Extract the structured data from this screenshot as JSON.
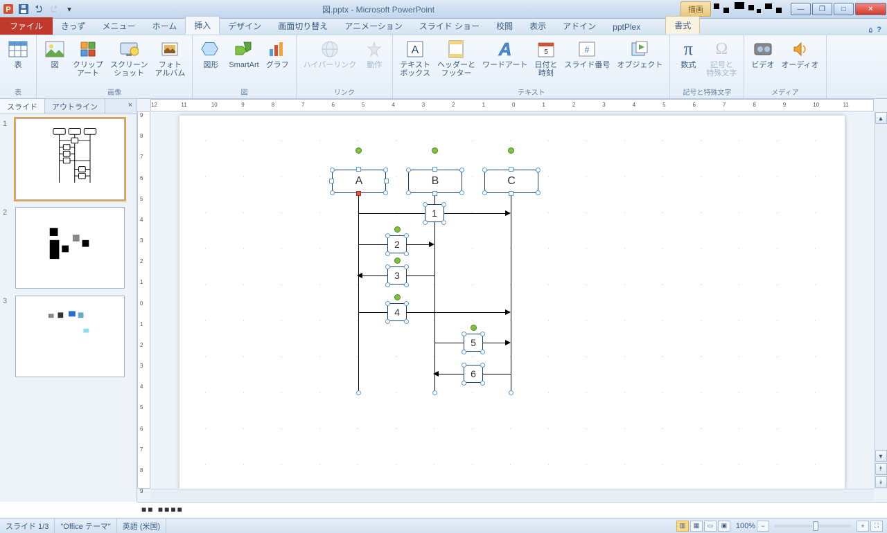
{
  "title": "図.pptx - Microsoft PowerPoint",
  "contextTab": "描画",
  "tabs": {
    "file": "ファイル",
    "kids": "きっず",
    "menu": "メニュー",
    "home": "ホーム",
    "insert": "挿入",
    "design": "デザイン",
    "transition": "画面切り替え",
    "animation": "アニメーション",
    "slideshow": "スライド ショー",
    "review": "校閲",
    "view": "表示",
    "addin": "アドイン",
    "pptplex": "pptPlex",
    "format": "書式"
  },
  "ribbon": {
    "groups": {
      "tables": {
        "label": "表",
        "btns": {
          "table": "表"
        }
      },
      "images": {
        "label": "画像",
        "btns": {
          "pic": "図",
          "clip": "クリップ\nアート",
          "screen": "スクリーン\nショット",
          "album": "フォト\nアルバム"
        }
      },
      "illus": {
        "label": "図",
        "btns": {
          "shapes": "図形",
          "smart": "SmartArt",
          "chart": "グラフ"
        }
      },
      "links": {
        "label": "リンク",
        "btns": {
          "hyper": "ハイパーリンク",
          "action": "動作"
        }
      },
      "text": {
        "label": "テキスト",
        "btns": {
          "textbox": "テキスト\nボックス",
          "hf": "ヘッダーと\nフッター",
          "wa": "ワードアート",
          "dt": "日付と\n時刻",
          "sn": "スライド番号",
          "obj": "オブジェクト"
        }
      },
      "symbols": {
        "label": "記号と特殊文字",
        "btns": {
          "eq": "数式",
          "sym": "記号と\n特殊文字"
        }
      },
      "media": {
        "label": "メディア",
        "btns": {
          "video": "ビデオ",
          "audio": "オーディオ"
        }
      }
    }
  },
  "panel": {
    "slides": "スライド",
    "outline": "アウトライン"
  },
  "diagram": {
    "headers": [
      "A",
      "B",
      "C"
    ],
    "rows": [
      "1",
      "2",
      "3",
      "4",
      "5",
      "6"
    ]
  },
  "status": {
    "slide": "スライド 1/3",
    "theme": "\"Office テーマ\"",
    "lang": "英語 (米国)",
    "zoom": "100%"
  },
  "notes": "■■ ■■■■"
}
